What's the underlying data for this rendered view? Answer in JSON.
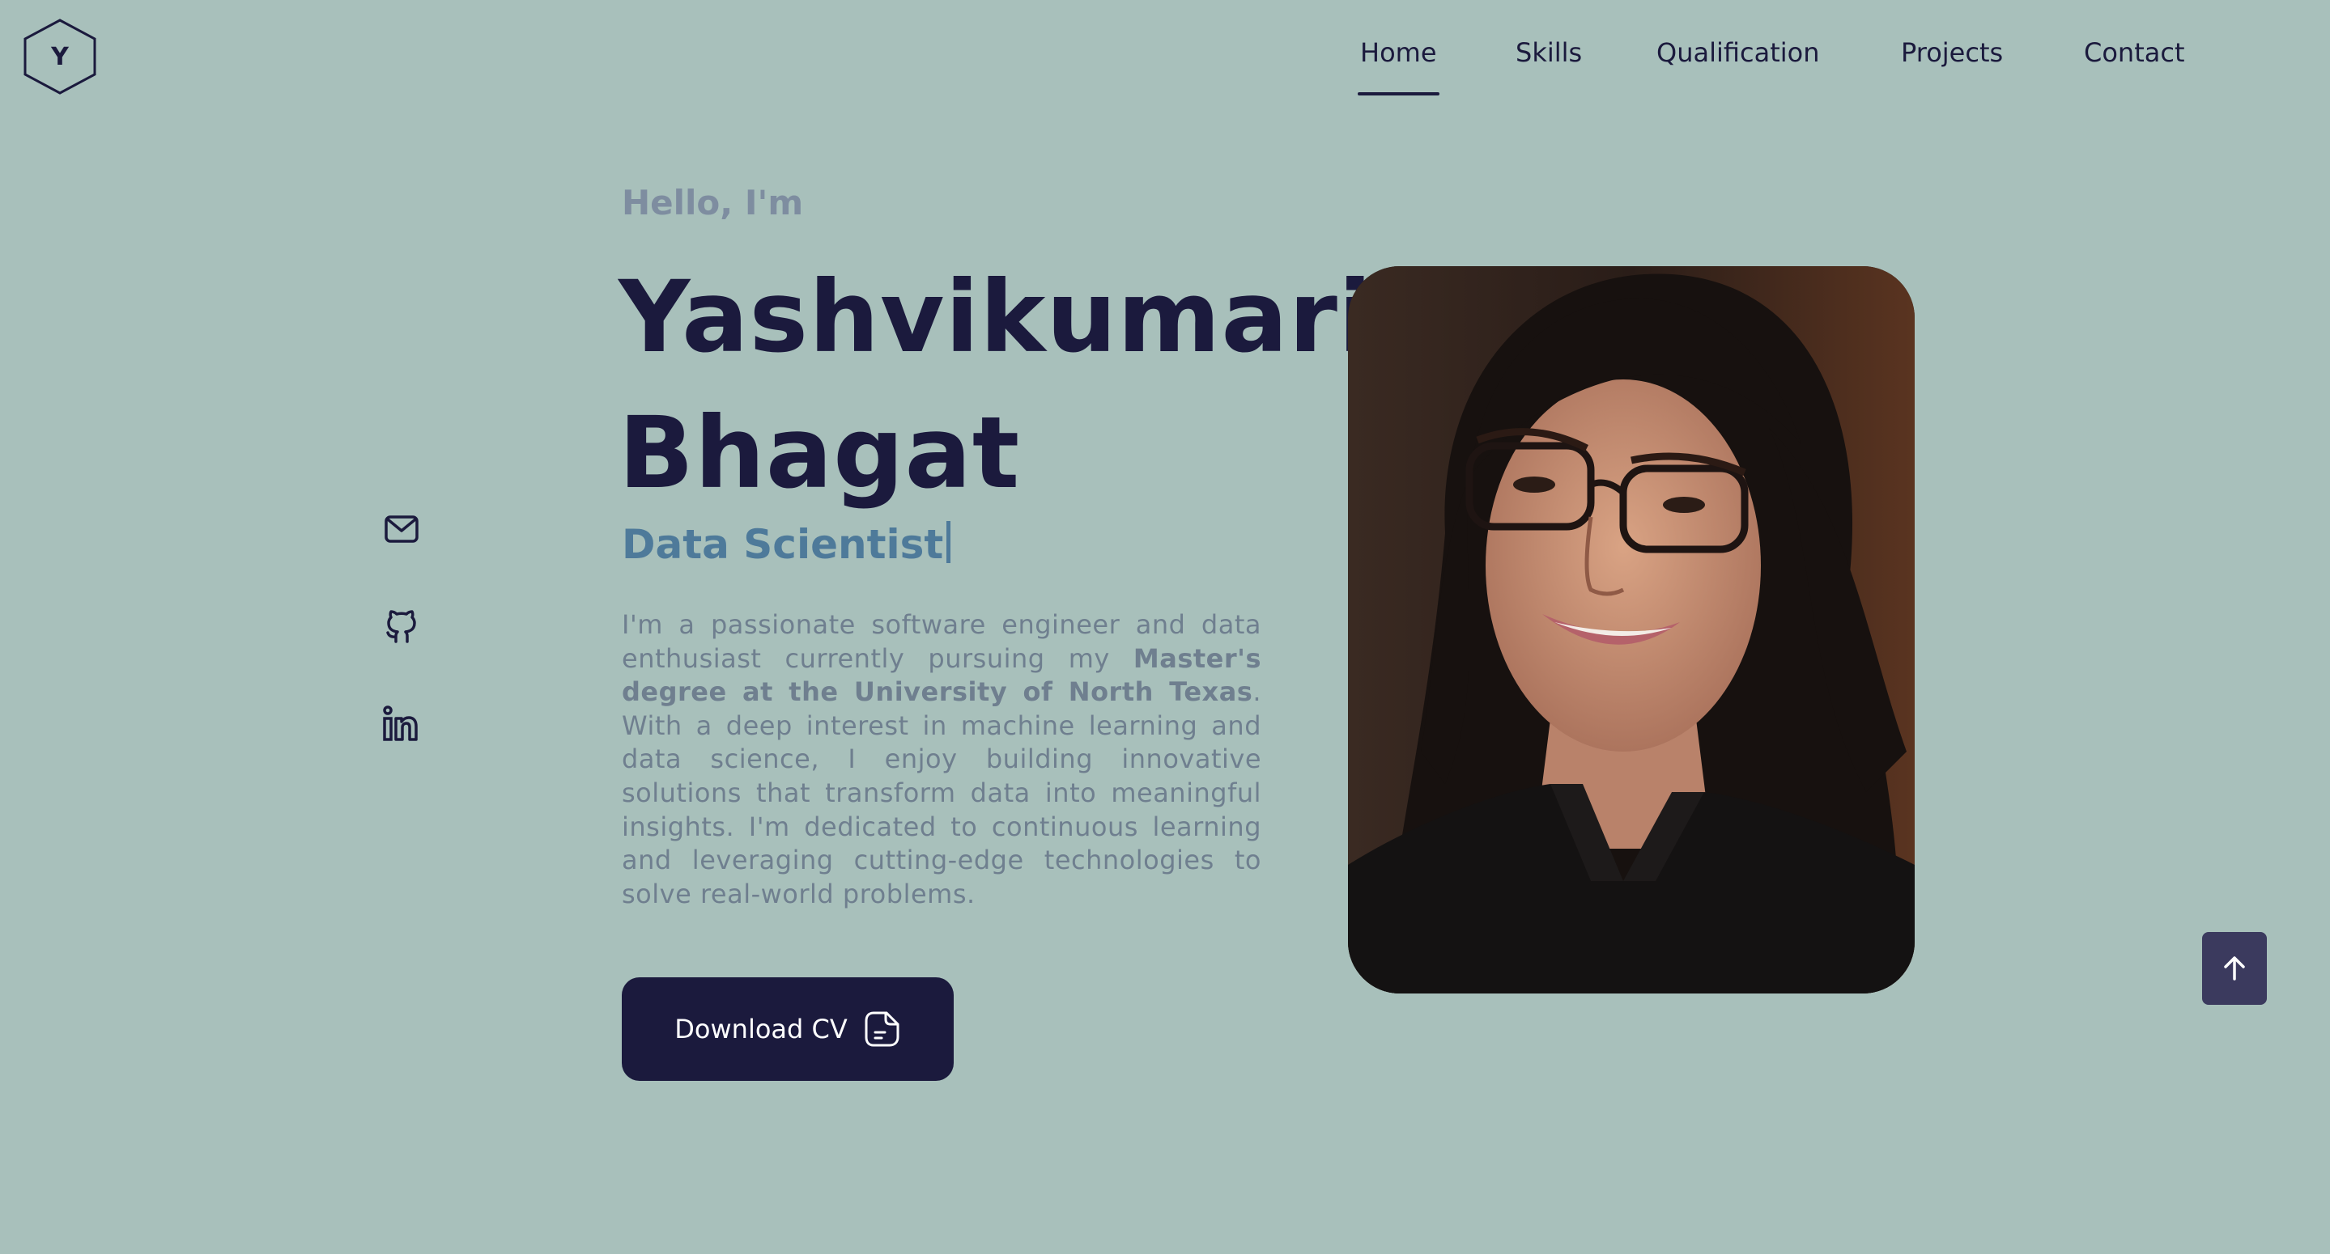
{
  "logo": {
    "letter": "Y"
  },
  "nav": {
    "items": [
      {
        "label": "Home",
        "active": true
      },
      {
        "label": "Skills",
        "active": false
      },
      {
        "label": "Qualification",
        "active": false
      },
      {
        "label": "Projects",
        "active": false
      },
      {
        "label": "Contact",
        "active": false
      }
    ]
  },
  "socials": [
    "mail-icon",
    "github-icon",
    "linkedin-icon"
  ],
  "hero": {
    "greeting": "Hello, I'm",
    "first_name": "Yashvikumari",
    "last_name": "Bhagat",
    "role": "Data Scientist",
    "bio_part1": "I'm a passionate software engineer and data enthusiast currently pursuing my ",
    "bio_bold": "Master's degree at the University of North Texas",
    "bio_part2": ". With a deep interest in machine learning and data science, I enjoy building innovative solutions that transform data into meaningful insights. I'm dedicated to continuous learning and leveraging cutting-edge technologies to solve real-world problems.",
    "cv_button": "Download CV"
  },
  "colors": {
    "background": "#a8c0bb",
    "primary": "#1b1a3d",
    "role_accent": "#4e7a9a",
    "muted_text": "#6f7f8f"
  }
}
